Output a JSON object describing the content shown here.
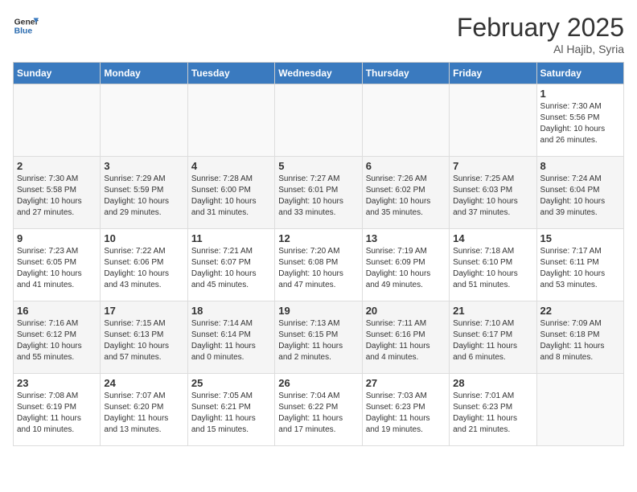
{
  "header": {
    "logo_general": "General",
    "logo_blue": "Blue",
    "title": "February 2025",
    "subtitle": "Al Hajib, Syria"
  },
  "days_of_week": [
    "Sunday",
    "Monday",
    "Tuesday",
    "Wednesday",
    "Thursday",
    "Friday",
    "Saturday"
  ],
  "weeks": [
    [
      {
        "day": "",
        "info": ""
      },
      {
        "day": "",
        "info": ""
      },
      {
        "day": "",
        "info": ""
      },
      {
        "day": "",
        "info": ""
      },
      {
        "day": "",
        "info": ""
      },
      {
        "day": "",
        "info": ""
      },
      {
        "day": "1",
        "info": "Sunrise: 7:30 AM\nSunset: 5:56 PM\nDaylight: 10 hours\nand 26 minutes."
      }
    ],
    [
      {
        "day": "2",
        "info": "Sunrise: 7:30 AM\nSunset: 5:58 PM\nDaylight: 10 hours\nand 27 minutes."
      },
      {
        "day": "3",
        "info": "Sunrise: 7:29 AM\nSunset: 5:59 PM\nDaylight: 10 hours\nand 29 minutes."
      },
      {
        "day": "4",
        "info": "Sunrise: 7:28 AM\nSunset: 6:00 PM\nDaylight: 10 hours\nand 31 minutes."
      },
      {
        "day": "5",
        "info": "Sunrise: 7:27 AM\nSunset: 6:01 PM\nDaylight: 10 hours\nand 33 minutes."
      },
      {
        "day": "6",
        "info": "Sunrise: 7:26 AM\nSunset: 6:02 PM\nDaylight: 10 hours\nand 35 minutes."
      },
      {
        "day": "7",
        "info": "Sunrise: 7:25 AM\nSunset: 6:03 PM\nDaylight: 10 hours\nand 37 minutes."
      },
      {
        "day": "8",
        "info": "Sunrise: 7:24 AM\nSunset: 6:04 PM\nDaylight: 10 hours\nand 39 minutes."
      }
    ],
    [
      {
        "day": "9",
        "info": "Sunrise: 7:23 AM\nSunset: 6:05 PM\nDaylight: 10 hours\nand 41 minutes."
      },
      {
        "day": "10",
        "info": "Sunrise: 7:22 AM\nSunset: 6:06 PM\nDaylight: 10 hours\nand 43 minutes."
      },
      {
        "day": "11",
        "info": "Sunrise: 7:21 AM\nSunset: 6:07 PM\nDaylight: 10 hours\nand 45 minutes."
      },
      {
        "day": "12",
        "info": "Sunrise: 7:20 AM\nSunset: 6:08 PM\nDaylight: 10 hours\nand 47 minutes."
      },
      {
        "day": "13",
        "info": "Sunrise: 7:19 AM\nSunset: 6:09 PM\nDaylight: 10 hours\nand 49 minutes."
      },
      {
        "day": "14",
        "info": "Sunrise: 7:18 AM\nSunset: 6:10 PM\nDaylight: 10 hours\nand 51 minutes."
      },
      {
        "day": "15",
        "info": "Sunrise: 7:17 AM\nSunset: 6:11 PM\nDaylight: 10 hours\nand 53 minutes."
      }
    ],
    [
      {
        "day": "16",
        "info": "Sunrise: 7:16 AM\nSunset: 6:12 PM\nDaylight: 10 hours\nand 55 minutes."
      },
      {
        "day": "17",
        "info": "Sunrise: 7:15 AM\nSunset: 6:13 PM\nDaylight: 10 hours\nand 57 minutes."
      },
      {
        "day": "18",
        "info": "Sunrise: 7:14 AM\nSunset: 6:14 PM\nDaylight: 11 hours\nand 0 minutes."
      },
      {
        "day": "19",
        "info": "Sunrise: 7:13 AM\nSunset: 6:15 PM\nDaylight: 11 hours\nand 2 minutes."
      },
      {
        "day": "20",
        "info": "Sunrise: 7:11 AM\nSunset: 6:16 PM\nDaylight: 11 hours\nand 4 minutes."
      },
      {
        "day": "21",
        "info": "Sunrise: 7:10 AM\nSunset: 6:17 PM\nDaylight: 11 hours\nand 6 minutes."
      },
      {
        "day": "22",
        "info": "Sunrise: 7:09 AM\nSunset: 6:18 PM\nDaylight: 11 hours\nand 8 minutes."
      }
    ],
    [
      {
        "day": "23",
        "info": "Sunrise: 7:08 AM\nSunset: 6:19 PM\nDaylight: 11 hours\nand 10 minutes."
      },
      {
        "day": "24",
        "info": "Sunrise: 7:07 AM\nSunset: 6:20 PM\nDaylight: 11 hours\nand 13 minutes."
      },
      {
        "day": "25",
        "info": "Sunrise: 7:05 AM\nSunset: 6:21 PM\nDaylight: 11 hours\nand 15 minutes."
      },
      {
        "day": "26",
        "info": "Sunrise: 7:04 AM\nSunset: 6:22 PM\nDaylight: 11 hours\nand 17 minutes."
      },
      {
        "day": "27",
        "info": "Sunrise: 7:03 AM\nSunset: 6:23 PM\nDaylight: 11 hours\nand 19 minutes."
      },
      {
        "day": "28",
        "info": "Sunrise: 7:01 AM\nSunset: 6:23 PM\nDaylight: 11 hours\nand 21 minutes."
      },
      {
        "day": "",
        "info": ""
      }
    ]
  ]
}
